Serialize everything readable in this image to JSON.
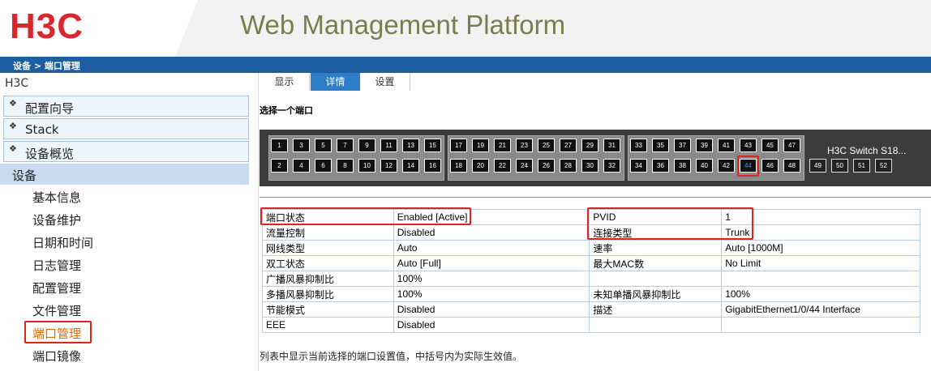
{
  "header": {
    "logo": "H3C",
    "title": "Web Management Platform"
  },
  "breadcrumb": "设备 > 端口管理",
  "sidebar": {
    "root": "H3C",
    "groups": [
      {
        "label": "配置向导"
      },
      {
        "label": "Stack"
      },
      {
        "label": "设备概览"
      }
    ],
    "active_group": "设备",
    "items": [
      {
        "label": "基本信息"
      },
      {
        "label": "设备维护"
      },
      {
        "label": "日期和时间"
      },
      {
        "label": "日志管理"
      },
      {
        "label": "配置管理"
      },
      {
        "label": "文件管理"
      },
      {
        "label": "端口管理"
      },
      {
        "label": "端口镜像"
      }
    ]
  },
  "tabs": [
    {
      "label": "显示"
    },
    {
      "label": "详情"
    },
    {
      "label": "设置"
    }
  ],
  "section_title": "选择一个端口",
  "switch": {
    "label": "H3C Switch S18...",
    "top_ports": [
      "1",
      "3",
      "5",
      "7",
      "9",
      "11",
      "13",
      "15",
      "17",
      "19",
      "21",
      "23",
      "25",
      "27",
      "29",
      "31",
      "33",
      "35",
      "37",
      "39",
      "41",
      "43",
      "45",
      "47"
    ],
    "bottom_ports": [
      "2",
      "4",
      "6",
      "8",
      "10",
      "12",
      "14",
      "16",
      "18",
      "20",
      "22",
      "24",
      "26",
      "28",
      "30",
      "32",
      "34",
      "36",
      "38",
      "40",
      "42",
      "44",
      "46",
      "48"
    ],
    "sfp_ports": [
      "49",
      "50",
      "51",
      "52"
    ],
    "selected_port": "44"
  },
  "table": {
    "rows": [
      [
        "端口状态",
        "Enabled [Active]",
        "PVID",
        "1"
      ],
      [
        "流量控制",
        "Disabled",
        "连接类型",
        "Trunk"
      ],
      [
        "网线类型",
        "Auto",
        "速率",
        "Auto [1000M]"
      ],
      [
        "双工状态",
        "Auto [Full]",
        "最大MAC数",
        "No Limit"
      ],
      [
        "广播风暴抑制比",
        "100%",
        "",
        ""
      ],
      [
        "多播风暴抑制比",
        "100%",
        "未知单播风暴抑制比",
        "100%"
      ],
      [
        "节能模式",
        "Disabled",
        "描述",
        "GigabitEthernet1/0/44 Interface"
      ],
      [
        "EEE",
        "Disabled",
        "",
        ""
      ]
    ]
  },
  "footnote": "列表中显示当前选择的端口设置值，中括号内为实际生效值。",
  "colors": {
    "brand_red": "#d9272e",
    "nav_blue": "#1d5ea0",
    "tab_active": "#2e7dc8",
    "highlight_red": "#e2231a"
  }
}
